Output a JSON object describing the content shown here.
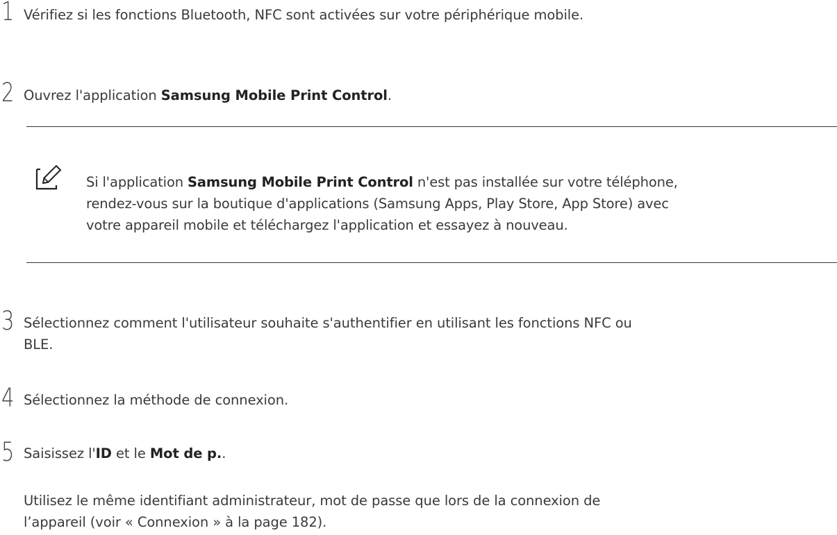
{
  "steps": [
    {
      "number": "1",
      "text": "Vérifiez si les fonctions Bluetooth, NFC sont activées sur votre périphérique mobile."
    },
    {
      "number": "2",
      "pre": "Ouvrez l'application ",
      "bold": "Samsung Mobile Print Control",
      "post": "."
    },
    {
      "number": "3",
      "line1": "Sélectionnez comment l'utilisateur souhaite s'authentifier en utilisant les fonctions NFC ou",
      "line2": "BLE."
    },
    {
      "number": "4",
      "text": "Sélectionnez la méthode de connexion."
    },
    {
      "number": "5",
      "pre": "Saisissez l'",
      "bold1": "ID",
      "mid": " et le ",
      "bold2": "Mot de p.",
      "post": ".",
      "detail_line1": "Utilisez le même identifiant administrateur, mot de passe que lors de la connexion de",
      "detail_line2": "l’appareil (voir « Connexion » à la page 182)."
    }
  ],
  "note": {
    "icon": "note-pencil-icon",
    "pre": "Si l'application ",
    "bold": "Samsung Mobile Print Control",
    "post": " n'est pas installée sur votre téléphone,",
    "line2": "rendez-vous sur la boutique d'applications (Samsung Apps, Play Store, App Store) avec",
    "line3": "votre appareil mobile et téléchargez l'application et essayez à nouveau."
  }
}
